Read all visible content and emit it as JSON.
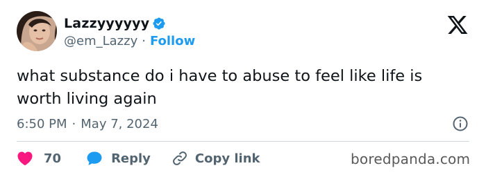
{
  "author": {
    "display_name": "Lazzyyyyyy",
    "handle": "@em_Lazzy",
    "separator": "·",
    "follow_label": "Follow",
    "verified": true
  },
  "brand": {
    "logo": "x-logo-icon"
  },
  "tweet": {
    "text": "what substance do i have to abuse to feel like life is worth living again",
    "time": "6:50 PM",
    "separator": "·",
    "date": "May 7, 2024"
  },
  "actions": {
    "like_count": "70",
    "reply_label": "Reply",
    "copy_label": "Copy link"
  },
  "watermark": {
    "text": "boredpanda.com"
  },
  "colors": {
    "accent": "#1d9bf0",
    "like": "#f91880",
    "text": "#0f1419",
    "muted": "#536471",
    "divider": "#cfd9de"
  }
}
